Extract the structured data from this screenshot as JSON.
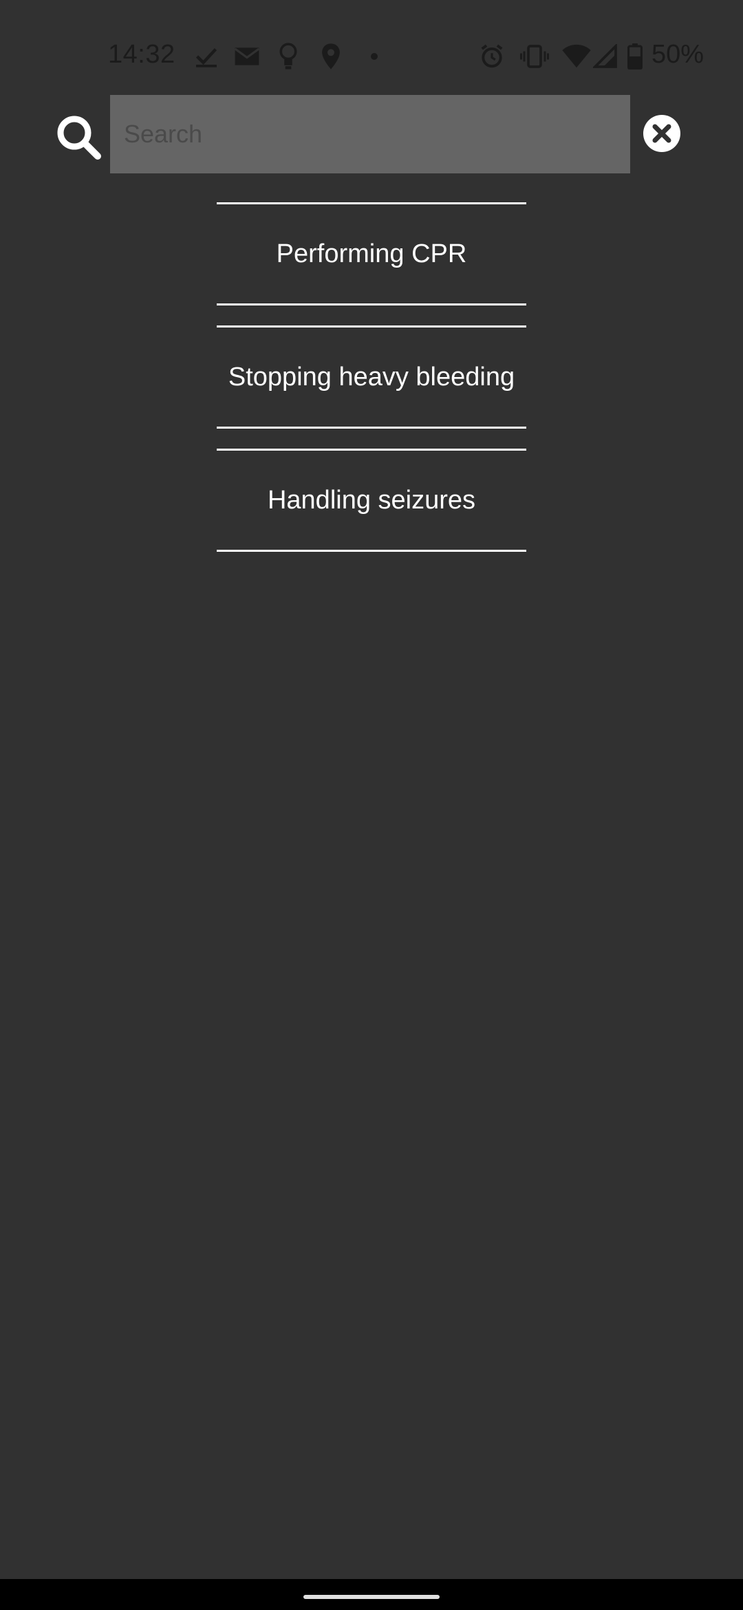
{
  "status_bar": {
    "time": "14:32",
    "notification_icons": [
      "check-icon",
      "mail-icon",
      "lightbulb-icon",
      "location-icon",
      "dot-icon"
    ],
    "system_icons": [
      "alarm-icon",
      "vibrate-icon",
      "wifi-icon",
      "signal-icon",
      "battery-icon"
    ],
    "battery_percent": "50%"
  },
  "search": {
    "placeholder": "Search",
    "value": ""
  },
  "results": [
    {
      "label": "Performing CPR"
    },
    {
      "label": "Stopping heavy bleeding"
    },
    {
      "label": "Handling seizures"
    }
  ],
  "colors": {
    "background": "#313131",
    "search_field": "#656565",
    "text": "#ffffff",
    "nav_bar": "#000000"
  }
}
